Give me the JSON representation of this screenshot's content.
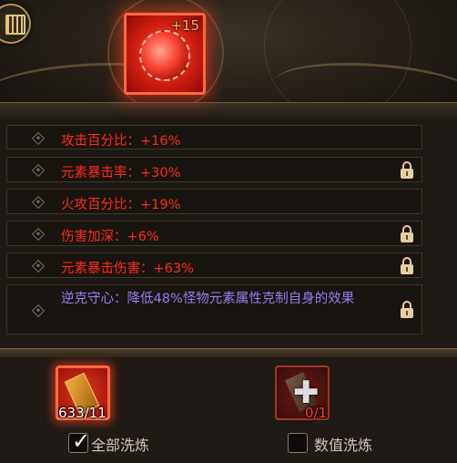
{
  "item": {
    "enhance_level": "+15"
  },
  "attributes": [
    {
      "text": "攻击百分比：+16%",
      "locked": false,
      "color": "#ff2a1a"
    },
    {
      "text": "元素暴击率：+30%",
      "locked": true,
      "color": "#ff2a1a"
    },
    {
      "text": "火攻百分比：+19%",
      "locked": false,
      "color": "#ff2a1a"
    },
    {
      "text": "伤害加深：+6%",
      "locked": true,
      "color": "#ff2a1a"
    },
    {
      "text": "元素暴击伤害：+63%",
      "locked": true,
      "color": "#ff2a1a"
    },
    {
      "text": "逆克守心：降低48%怪物元素属性克制自身的效果",
      "locked": true,
      "color": "#9a7cf0"
    }
  ],
  "materials": [
    {
      "count": "633/11",
      "icon": "refine-scroll-icon"
    },
    {
      "count": "0/1",
      "icon": "value-refine-scroll-icon"
    }
  ],
  "options": {
    "full_refine": {
      "label": "全部洗炼",
      "checked": true
    },
    "value_refine": {
      "label": "数值洗炼",
      "checked": false
    }
  }
}
